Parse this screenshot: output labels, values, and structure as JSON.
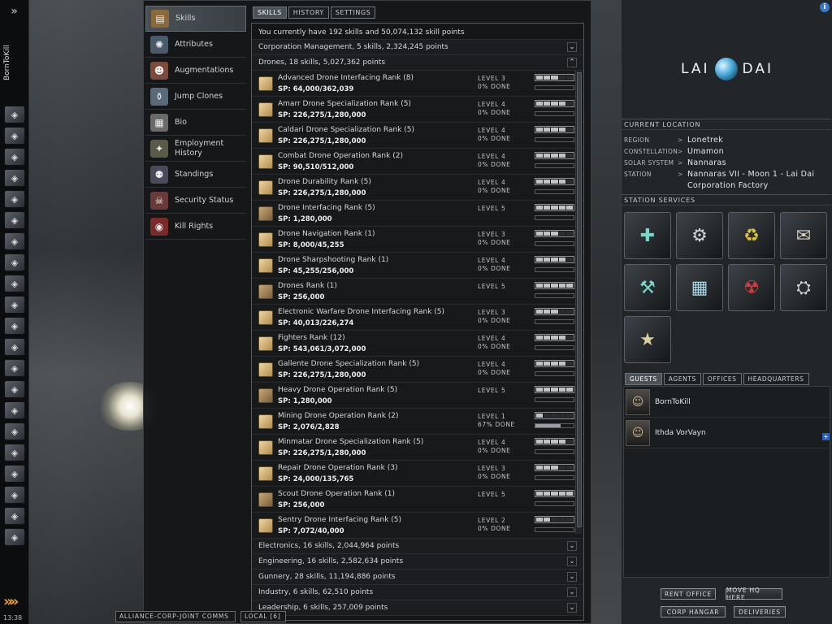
{
  "neocom": {
    "character_name": "BornToKill",
    "expand_icon": "double-chevron-right",
    "clock": "13:38",
    "buttons": [
      "character-sheet",
      "portrait",
      "mail",
      "notepad",
      "market",
      "ship-hangar",
      "fitting",
      "star-map",
      "corporation",
      "cargo",
      "science",
      "calculator",
      "help",
      "assets",
      "wallet",
      "journal",
      "people",
      "contracts",
      "portrait2",
      "chat",
      "fleet"
    ]
  },
  "nav": {
    "items": [
      {
        "label": "Skills",
        "icon": "skillbook-icon"
      },
      {
        "label": "Attributes",
        "icon": "attributes-icon"
      },
      {
        "label": "Augmentations",
        "icon": "augmentations-icon"
      },
      {
        "label": "Jump Clones",
        "icon": "jump-clones-icon"
      },
      {
        "label": "Bio",
        "icon": "bio-icon"
      },
      {
        "label": "Employment\nHistory",
        "icon": "employment-icon"
      },
      {
        "label": "Standings",
        "icon": "standings-icon"
      },
      {
        "label": "Security Status",
        "icon": "security-icon"
      },
      {
        "label": "Kill Rights",
        "icon": "kill-rights-icon"
      }
    ]
  },
  "tabs": [
    "SKILLS",
    "HISTORY",
    "SETTINGS"
  ],
  "summary": "You currently have 192 skills and 50,074,132 skill points",
  "groups_top": [
    {
      "label": "Corporation Management, 5 skills, 2,324,245 points",
      "expanded": false
    },
    {
      "label": "Drones, 18 skills, 5,027,362 points",
      "expanded": true
    }
  ],
  "skills": [
    {
      "name": "Advanced Drone Interfacing Rank (8)",
      "sp": "SP:  64,000/362,039",
      "level": "LEVEL 3",
      "done": "0% DONE",
      "lvl": 3,
      "progress": 0
    },
    {
      "name": "Amarr Drone Specialization Rank (5)",
      "sp": "SP:  226,275/1,280,000",
      "level": "LEVEL 4",
      "done": "0% DONE",
      "lvl": 4,
      "progress": 0
    },
    {
      "name": "Caldari Drone Specialization Rank (5)",
      "sp": "SP:  226,275/1,280,000",
      "level": "LEVEL 4",
      "done": "0% DONE",
      "lvl": 4,
      "progress": 0
    },
    {
      "name": "Combat Drone Operation Rank (2)",
      "sp": "SP:  90,510/512,000",
      "level": "LEVEL 4",
      "done": "0% DONE",
      "lvl": 4,
      "progress": 0
    },
    {
      "name": "Drone Durability Rank (5)",
      "sp": "SP:  226,275/1,280,000",
      "level": "LEVEL 4",
      "done": "0% DONE",
      "lvl": 4,
      "progress": 0
    },
    {
      "name": "Drone Interfacing Rank (5)",
      "sp": "SP:  1,280,000",
      "level": "LEVEL 5",
      "done": "",
      "lvl": 5,
      "progress": 0
    },
    {
      "name": "Drone Navigation Rank (1)",
      "sp": "SP:  8,000/45,255",
      "level": "LEVEL 3",
      "done": "0% DONE",
      "lvl": 3,
      "progress": 0
    },
    {
      "name": "Drone Sharpshooting Rank (1)",
      "sp": "SP:  45,255/256,000",
      "level": "LEVEL 4",
      "done": "0% DONE",
      "lvl": 4,
      "progress": 0
    },
    {
      "name": "Drones Rank (1)",
      "sp": "SP:  256,000",
      "level": "LEVEL 5",
      "done": "",
      "lvl": 5,
      "progress": 0
    },
    {
      "name": "Electronic Warfare Drone Interfacing Rank (5)",
      "sp": "SP:  40,013/226,274",
      "level": "LEVEL 3",
      "done": "0% DONE",
      "lvl": 3,
      "progress": 0
    },
    {
      "name": "Fighters Rank (12)",
      "sp": "SP:  543,061/3,072,000",
      "level": "LEVEL 4",
      "done": "0% DONE",
      "lvl": 4,
      "progress": 0
    },
    {
      "name": "Gallente Drone Specialization Rank (5)",
      "sp": "SP:  226,275/1,280,000",
      "level": "LEVEL 4",
      "done": "0% DONE",
      "lvl": 4,
      "progress": 0
    },
    {
      "name": "Heavy Drone Operation Rank (5)",
      "sp": "SP:  1,280,000",
      "level": "LEVEL 5",
      "done": "",
      "lvl": 5,
      "progress": 0
    },
    {
      "name": "Mining Drone Operation Rank (2)",
      "sp": "SP:  2,076/2,828",
      "level": "LEVEL 1",
      "done": "67% DONE",
      "lvl": 1,
      "progress": 67
    },
    {
      "name": "Minmatar Drone Specialization Rank (5)",
      "sp": "SP:  226,275/1,280,000",
      "level": "LEVEL 4",
      "done": "0% DONE",
      "lvl": 4,
      "progress": 0
    },
    {
      "name": "Repair Drone Operation Rank (3)",
      "sp": "SP:  24,000/135,765",
      "level": "LEVEL 3",
      "done": "0% DONE",
      "lvl": 3,
      "progress": 0
    },
    {
      "name": "Scout Drone Operation Rank (1)",
      "sp": "SP:  256,000",
      "level": "LEVEL 5",
      "done": "",
      "lvl": 5,
      "progress": 0
    },
    {
      "name": "Sentry Drone Interfacing Rank (5)",
      "sp": "SP:  7,072/40,000",
      "level": "LEVEL 2",
      "done": "0% DONE",
      "lvl": 2,
      "progress": 0
    }
  ],
  "groups_bottom": [
    {
      "label": "Electronics, 16 skills, 2,044,964 points",
      "expanded": false
    },
    {
      "label": "Engineering, 16 skills, 2,582,634 points",
      "expanded": false
    },
    {
      "label": "Gunnery, 28 skills, 11,194,886 points",
      "expanded": false
    },
    {
      "label": "Industry, 6 skills, 62,510 points",
      "expanded": false
    },
    {
      "label": "Leadership, 6 skills, 257,009 points",
      "expanded": false
    }
  ],
  "station": {
    "logo_left": "LAI",
    "logo_right": "DAI",
    "current_location_title": "CURRENT LOCATION",
    "location": [
      {
        "key": "REGION",
        "value": "Lonetrek"
      },
      {
        "key": "CONSTELLATION",
        "value": "Umamon"
      },
      {
        "key": "SOLAR SYSTEM",
        "value": "Nannaras"
      },
      {
        "key": "STATION",
        "value": "Nannaras VII - Moon 1 - Lai Dai Corporation Factory"
      }
    ],
    "services_title": "STATION SERVICES",
    "services": [
      "medical-icon",
      "repair-icon",
      "reprocessing-icon",
      "market-icon",
      "fitting-icon",
      "factory-icon",
      "bounty-icon",
      "refinery-icon",
      "security-office-icon"
    ],
    "guest_tabs": [
      "GUESTS",
      "AGENTS",
      "OFFICES",
      "HEADQUARTERS"
    ],
    "guests": [
      "BornToKill",
      "Ithda VorVayn"
    ],
    "buttons": [
      "RENT OFFICE",
      "MOVE HQ HERE",
      "CORP HANGAR",
      "DELIVERIES"
    ]
  },
  "chat_tabs": [
    "ALLIANCE-CORP-JOINT COMMS",
    "LOCAL [6]"
  ]
}
